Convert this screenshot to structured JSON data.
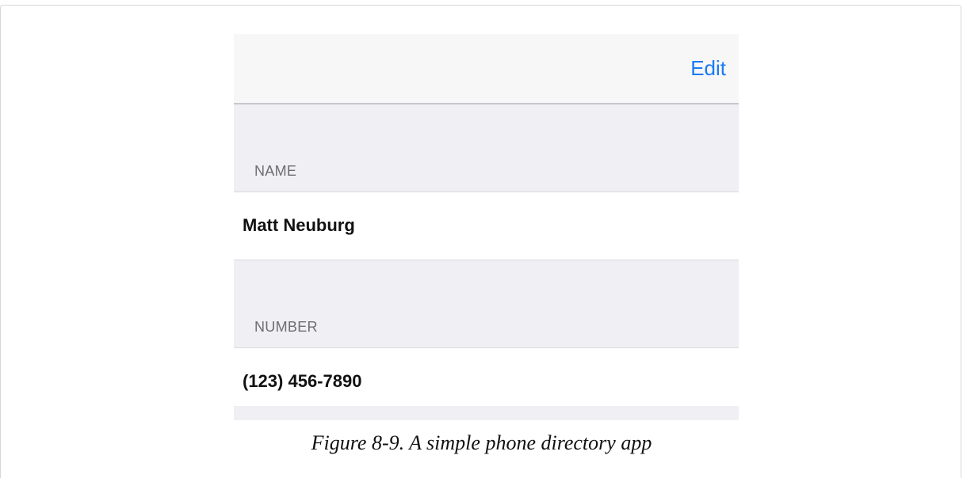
{
  "navbar": {
    "edit_label": "Edit"
  },
  "sections": [
    {
      "header": "NAME",
      "value": "Matt Neuburg"
    },
    {
      "header": "NUMBER",
      "value": "(123) 456-7890"
    }
  ],
  "caption": "Figure 8-9. A simple phone directory app",
  "colors": {
    "accent": "#1a7cf5",
    "grouped_background": "#efeff4",
    "navbar_background": "#f7f7f7",
    "section_header_text": "#6d6d72"
  }
}
